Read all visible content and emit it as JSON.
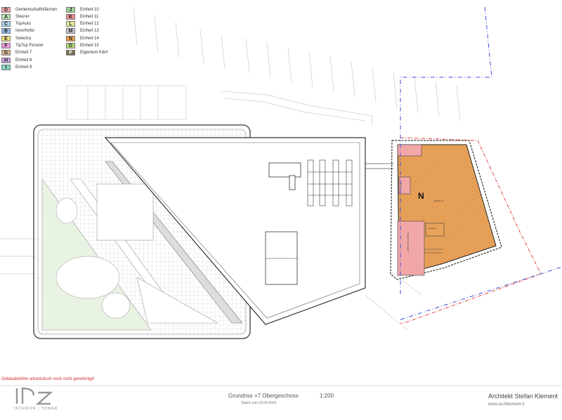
{
  "legend": [
    {
      "code": "D",
      "label": "Gemeinschaftsflächen",
      "color": "#f4a6a6"
    },
    {
      "code": "A",
      "label": "Steurer",
      "color": "#b7e3b0"
    },
    {
      "code": "C",
      "label": "TopAuto",
      "color": "#a8d8f0"
    },
    {
      "code": "B",
      "label": "Innerhofer",
      "color": "#8fb8e8"
    },
    {
      "code": "E",
      "label": "Selectra",
      "color": "#f1e27a"
    },
    {
      "code": "F",
      "label": "TipTop Fenster",
      "color": "#f19ae0"
    },
    {
      "code": "G",
      "label": "Einheit 7",
      "color": "#d8b48c"
    },
    {
      "code": "H",
      "label": "Einheit 8",
      "color": "#c9a2e6"
    },
    {
      "code": "I",
      "label": "Einheit 9",
      "color": "#7fd6c4"
    },
    {
      "code": "J",
      "label": "Einheit 10",
      "color": "#9fd49a"
    },
    {
      "code": "K",
      "label": "Einheit 11",
      "color": "#f08c8c"
    },
    {
      "code": "L",
      "label": "Einheit 12",
      "color": "#e6ea9a"
    },
    {
      "code": "M",
      "label": "Einheit 13",
      "color": "#c8c8c8"
    },
    {
      "code": "N",
      "label": "Einheit 14",
      "color": "#f0a04b"
    },
    {
      "code": "O",
      "label": "Einheit 15",
      "color": "#b7e07a"
    },
    {
      "code": "P",
      "label": "Eigentum K&H",
      "color": "#7a6a52"
    }
  ],
  "plan": {
    "unit_label": "N",
    "rooms": [
      "Einheit 14",
      "Aufzug",
      "Treppenhaus Etage 4",
      "Aufzug 2"
    ]
  },
  "warning": "Gebäudehöhe urbanistisch noch nicht genehmigt!",
  "title_block": {
    "title": "Grundriss +7 Obergeschoss",
    "scale": "1:200",
    "date": "Stand vom 23.04.2024",
    "architect": "Architekt Stefan Klement",
    "website": "www.archklement.it",
    "logo_text": "INTERIOR | TOWER"
  },
  "colors": {
    "unit_fill": "#e8a25a",
    "common_fill": "#f2a7a7",
    "red_line": "#e04040",
    "blue_line": "#3b4fd6"
  }
}
